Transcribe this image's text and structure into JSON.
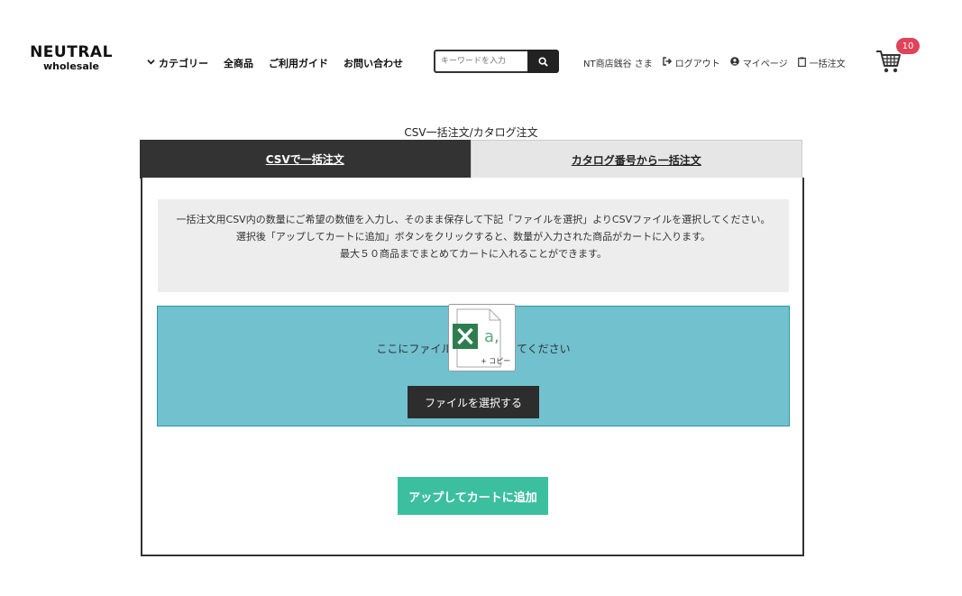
{
  "brand": {
    "line1": "NEUTRAL",
    "line2": "wholesale"
  },
  "nav": {
    "categories": "カテゴリー",
    "all_products": "全商品",
    "guide": "ご利用ガイド",
    "contact": "お問い合わせ"
  },
  "search": {
    "placeholder": "キーワードを入力",
    "icon": "search-icon"
  },
  "user_nav": {
    "user_name": "NT商店銭谷 さま",
    "logout": "ログアウト",
    "mypage": "マイページ",
    "bulk_order": "一括注文"
  },
  "cart": {
    "count": "10",
    "icon": "cart-icon"
  },
  "page": {
    "title": "CSV一括注文/カタログ注文"
  },
  "tabs": [
    {
      "label": "CSVで一括注文",
      "active": true
    },
    {
      "label": "カタログ番号から一括注文",
      "active": false
    }
  ],
  "info": {
    "line1": "一括注文用CSV内の数量にご希望の数値を入力し、そのまま保存して下記「ファイルを選択」よりCSVファイルを選択してください。",
    "line2": "選択後「アップしてカートに追加」ボタンをクリックすると、数量が入力された商品がカートに入ります。",
    "line3": "最大５０商品までまとめてカートに入れることができます。"
  },
  "drop_zone": {
    "text": "ここにファイルをドロップしてください",
    "select_button": "ファイルを選択する"
  },
  "drag_file": {
    "icon": "excel-file-icon",
    "copy_label": "+ コピー"
  },
  "upload_button": {
    "label": "アップしてカートに追加"
  },
  "colors": {
    "accent_dark": "#333333",
    "drop_zone": "#71c1cf",
    "upload_button": "#3bbf9e",
    "badge": "#e0435a"
  }
}
